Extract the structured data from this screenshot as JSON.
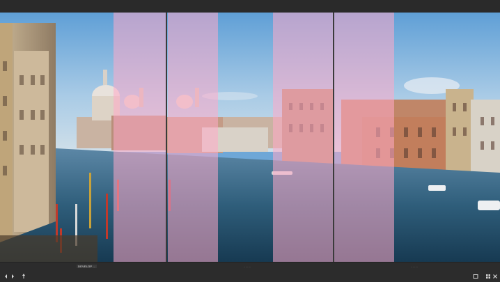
{
  "viewer": {
    "panels": [
      {
        "label": "DEVELOP ..."
      },
      {
        "label": "........"
      },
      {
        "label": "........"
      }
    ]
  },
  "controls": {
    "left": [
      {
        "icon": "arrow-left-icon"
      },
      {
        "icon": "arrow-right-icon"
      },
      {
        "icon": "pin-icon"
      }
    ],
    "right": [
      {
        "icon": "compare-icon"
      },
      {
        "icon": "grid-view-icon"
      },
      {
        "icon": "close-icon"
      }
    ]
  },
  "colors": {
    "overlay": "#ffaac8",
    "chrome": "#2b2b2b",
    "divider": "#3b3b3b"
  }
}
